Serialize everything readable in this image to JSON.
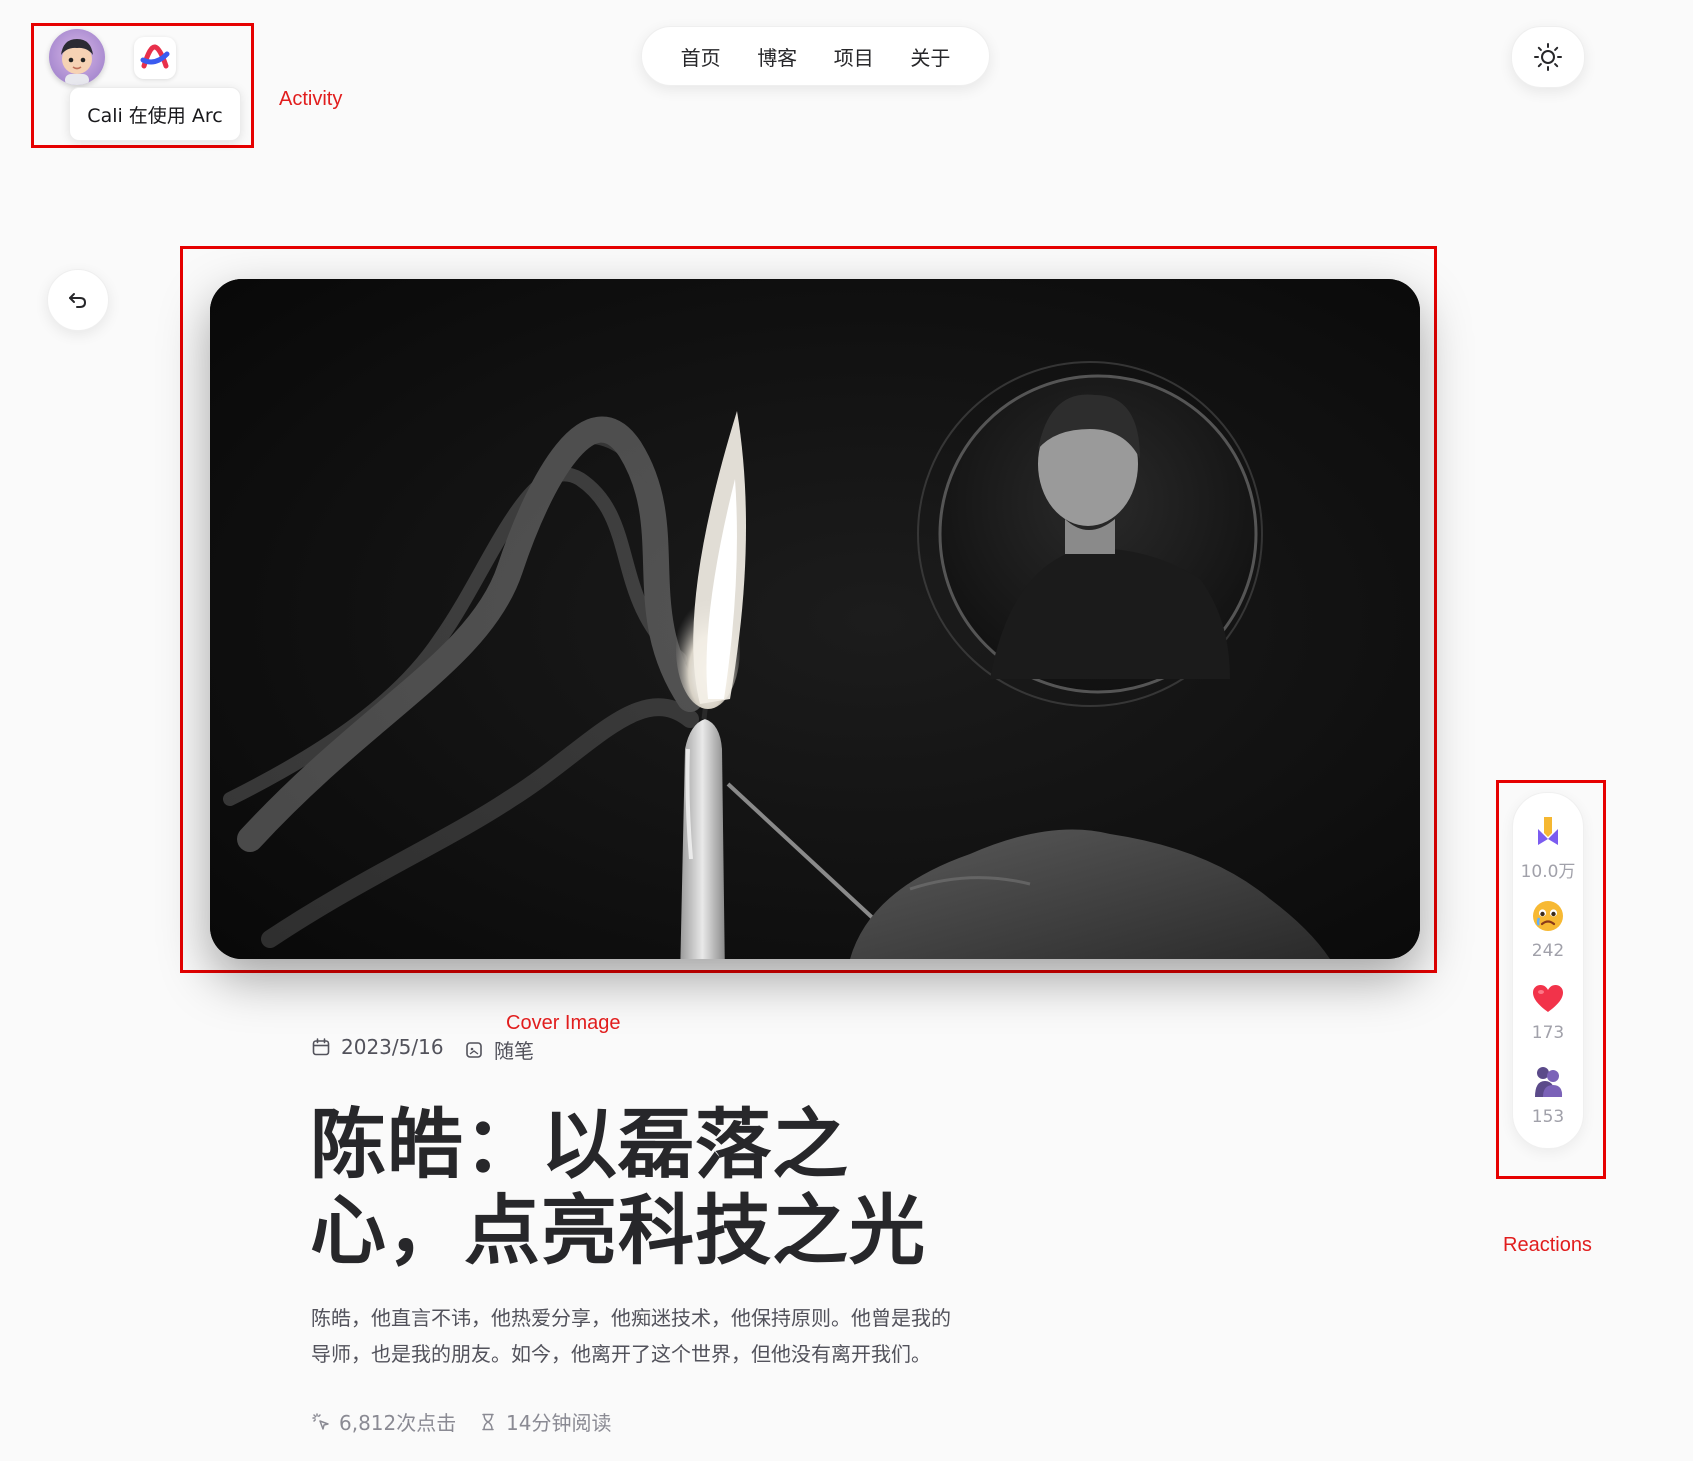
{
  "activity": {
    "app_name": "Arc",
    "tooltip": "Cali 在使用 Arc",
    "annotation": "Activity"
  },
  "nav": {
    "items": [
      "首页",
      "博客",
      "项目",
      "关于"
    ]
  },
  "cover": {
    "annotation": "Cover Image"
  },
  "post": {
    "date": "2023/5/16",
    "category": "随笔",
    "title_line1": "陈皓：以磊落之",
    "title_line2": "心，点亮科技之光",
    "description_line1": "陈皓，他直言不讳，他热爱分享，他痴迷技术，他保持原则。他曾是我的",
    "description_line2": "导师，也是我的朋友。如今，他离开了这个世界，但他没有离开我们。",
    "clicks": "6,812次点击",
    "read_time": "14分钟阅读"
  },
  "reactions": {
    "annotation": "Reactions",
    "items": [
      {
        "icon": "clap-icon",
        "count": "10.0万"
      },
      {
        "icon": "sad-face-icon",
        "count": "242"
      },
      {
        "icon": "heart-icon",
        "count": "173"
      },
      {
        "icon": "hug-icon",
        "count": "153"
      }
    ]
  },
  "colors": {
    "accent_annotation": "#e11d1d",
    "background": "#fafafa",
    "text": "#27272a"
  }
}
